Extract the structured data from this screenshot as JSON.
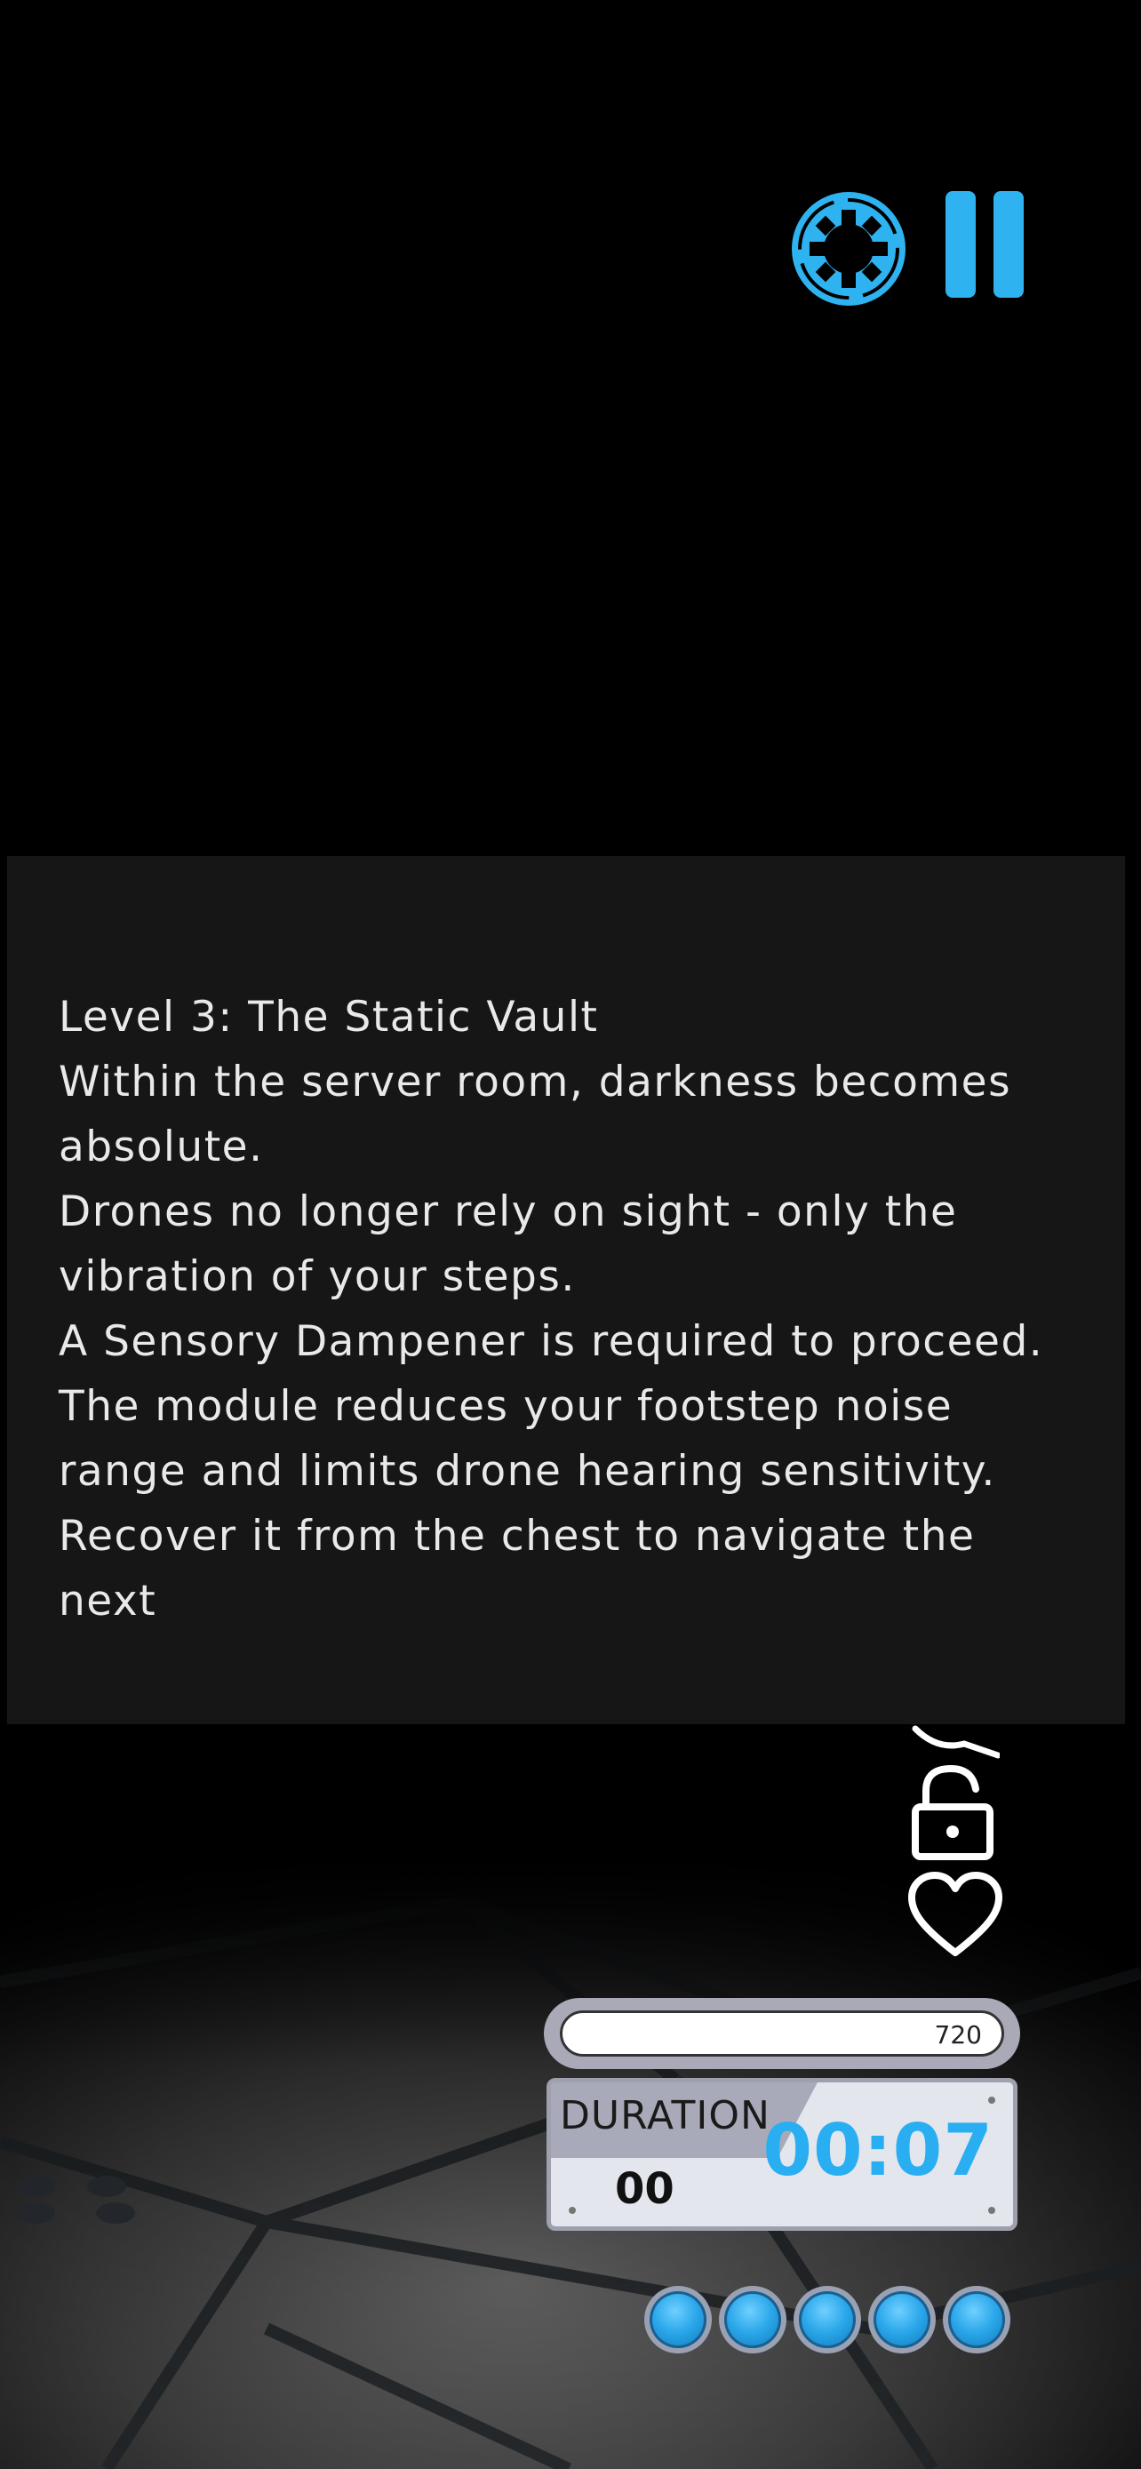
{
  "hud": {
    "settings_icon": "gear-icon",
    "pause_icon": "pause-icon",
    "accent_color": "#2fb3f0"
  },
  "story": {
    "lines": [
      "Level 3: The Static Vault",
      "Within the server room, darkness becomes absolute.",
      "Drones no longer rely on sight - only the vibration of your steps.",
      "A Sensory Dampener is required to proceed. The module reduces your footstep noise range and limits drone hearing sensitivity.",
      "Recover it from the chest to navigate the next"
    ]
  },
  "side_icons": [
    "unknown-icon",
    "unlock-icon",
    "heart-icon"
  ],
  "score": {
    "value": "720"
  },
  "duration": {
    "label": "DURATION",
    "sub_value": "00",
    "time": "00:07"
  },
  "lives": {
    "count": 5,
    "color": "#2aa7ea"
  }
}
